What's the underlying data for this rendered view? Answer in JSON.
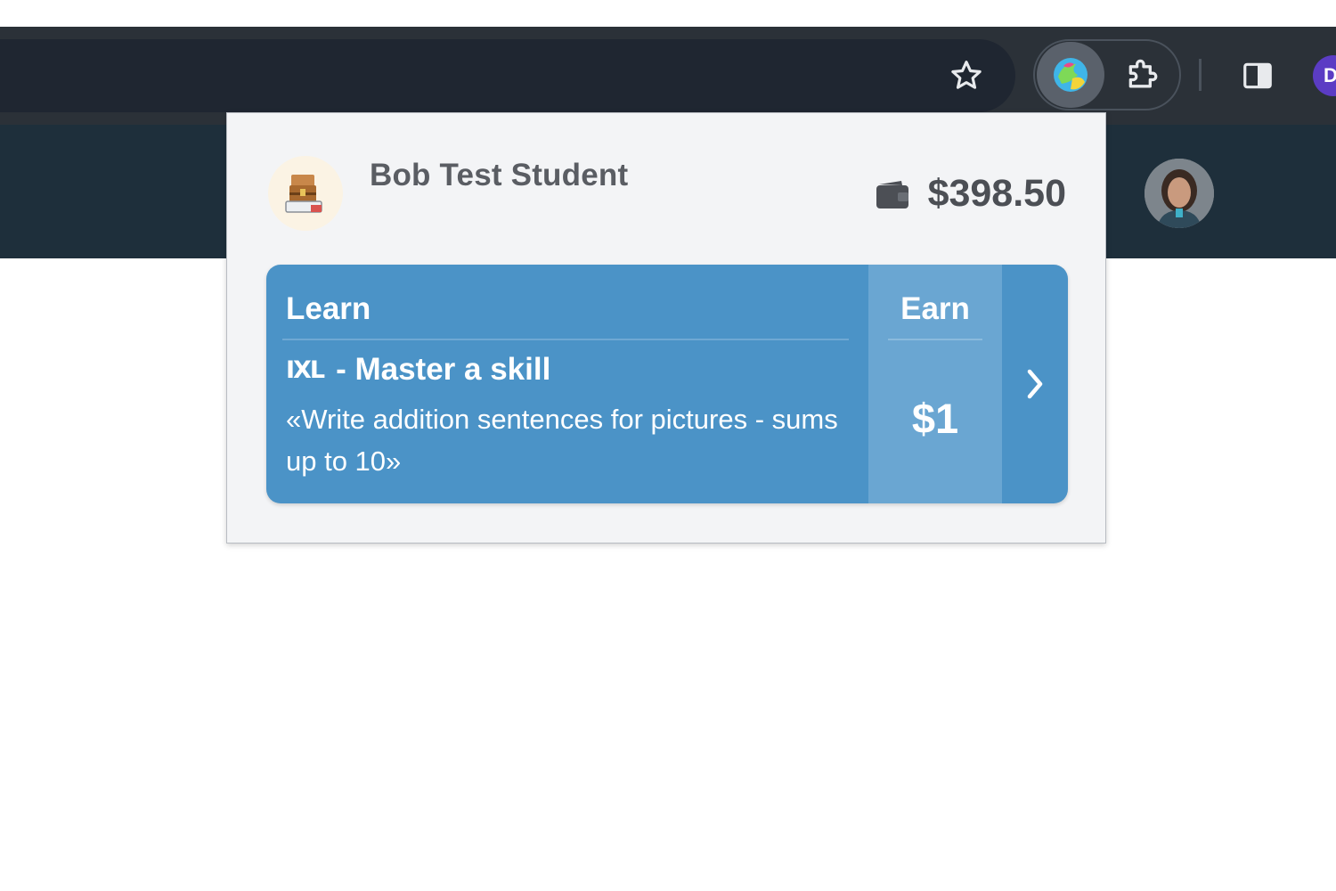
{
  "browser": {
    "bookmark_icon": "star-icon",
    "extension_icon": "extension-colorful-icon",
    "extensions_menu_icon": "puzzle-icon",
    "side_panel_icon": "side-panel-icon",
    "profile_initial": "D",
    "profile_color": "#5b3cc4"
  },
  "popup": {
    "user": {
      "name": "Bob Test Student",
      "avatar_icon": "treasure-chest-icon"
    },
    "wallet": {
      "icon": "wallet-icon",
      "balance": "$398.50"
    },
    "task": {
      "learn_label": "Learn",
      "earn_label": "Earn",
      "provider_logo": "IXL",
      "title": "- Master a skill",
      "description": "«Write addition sentences for pictures - sums up to 10»",
      "reward": "$1",
      "arrow_icon": "chevron-right-icon",
      "card_color": "#4b93c7",
      "earn_color": "#6aa6d2"
    }
  }
}
